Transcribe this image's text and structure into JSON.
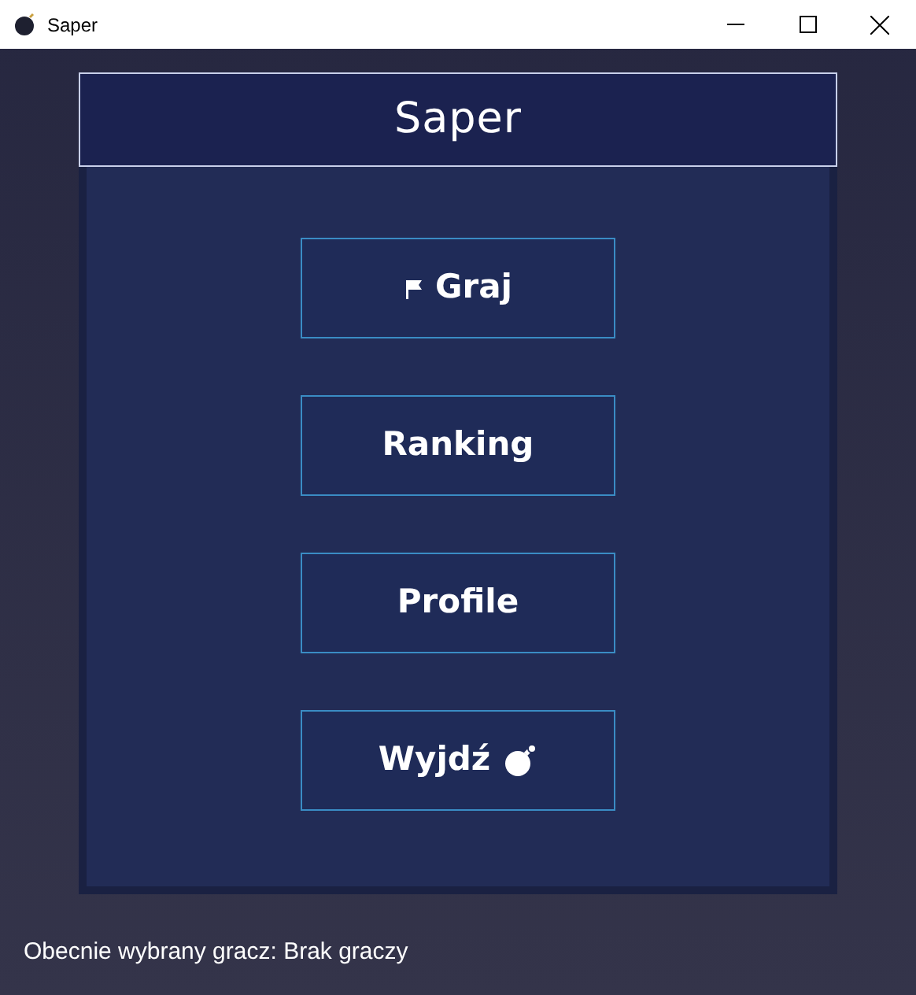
{
  "window": {
    "title": "Saper"
  },
  "header": {
    "title": "Saper"
  },
  "buttons": [
    {
      "label": "Graj",
      "kind": "flag"
    },
    {
      "label": "Ranking",
      "kind": "plain"
    },
    {
      "label": "Profile",
      "kind": "plain"
    },
    {
      "label": "Wyjdź",
      "kind": "bomb"
    }
  ],
  "status": "Obecnie wybrany gracz: Brak graczy"
}
